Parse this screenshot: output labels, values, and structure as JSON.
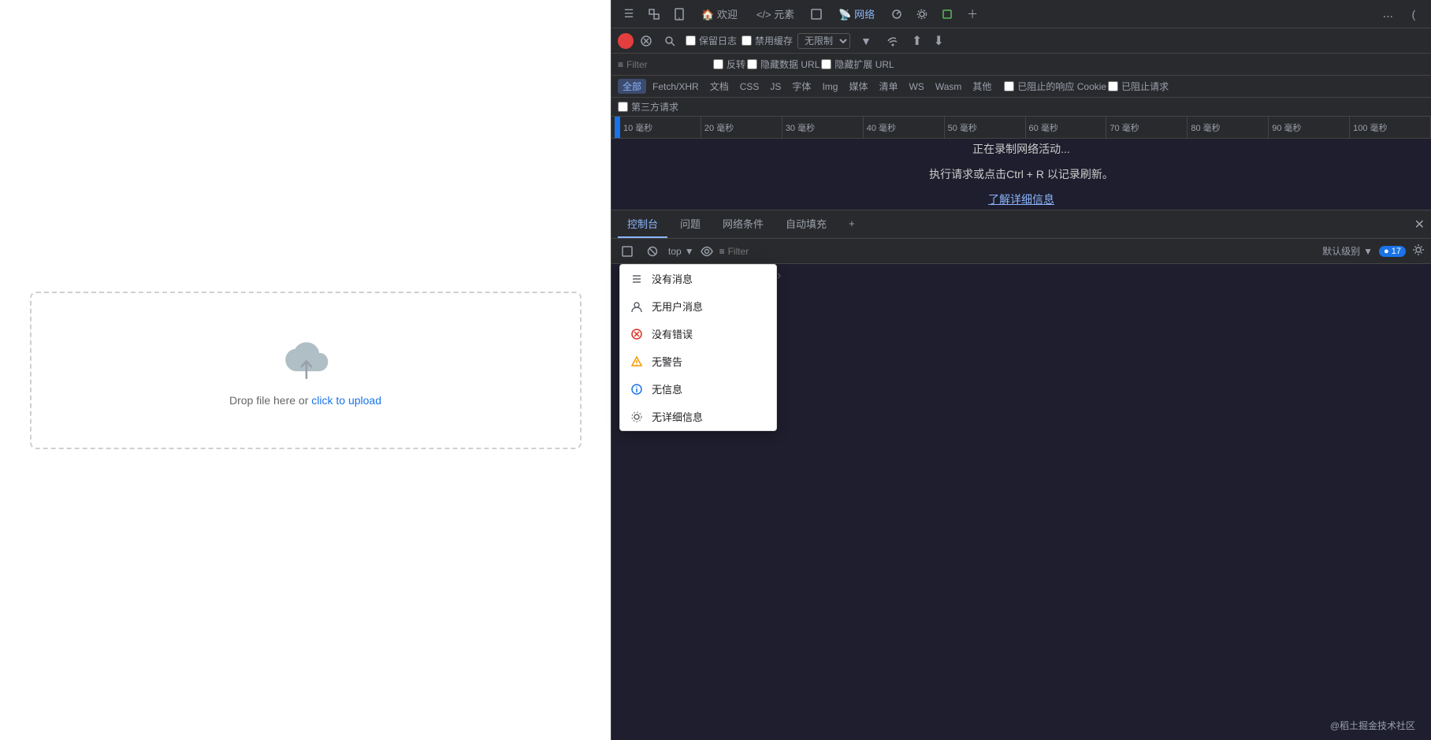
{
  "left_panel": {
    "upload": {
      "text": "Drop file here or ",
      "link_text": "click to upload"
    }
  },
  "devtools": {
    "toolbar": {
      "icon_buttons": [
        "☰",
        "⚡",
        "▭"
      ],
      "tabs": [
        {
          "id": "welcome",
          "label": "欢迎",
          "icon": "🏠"
        },
        {
          "id": "elements",
          "label": "元素",
          "icon": "</>"
        },
        {
          "id": "console2",
          "label": ""
        },
        {
          "id": "network",
          "label": "网络",
          "icon": "📡",
          "active": true
        },
        {
          "id": "perf",
          "label": ""
        },
        {
          "id": "settings2",
          "label": ""
        },
        {
          "id": "more",
          "label": "+"
        }
      ],
      "more_label": "..."
    },
    "network_toolbar": {
      "record_title": "录制",
      "clear_label": "⊘",
      "search_label": "🔍",
      "preserve_log_label": "保留日志",
      "disable_cache_label": "禁用缓存",
      "throttle_label": "无限制",
      "import_label": "⬆",
      "export_label": "⬇"
    },
    "filter_bar": {
      "filter_placeholder": "Filter",
      "invert_label": "反转",
      "hide_data_urls_label": "隐藏数据 URL",
      "hide_ext_label": "隐藏扩展 URL",
      "chips": [
        "全部",
        "Fetch/XHR",
        "文档",
        "CSS",
        "JS",
        "字体",
        "Img",
        "媒体",
        "清单",
        "WS",
        "Wasm",
        "其他"
      ],
      "blocked_label": "已阻止的响应 Cookie",
      "blocked_requests_label": "已阻止请求",
      "third_party_label": "第三方请求"
    },
    "timeline": {
      "ticks": [
        "10 毫秒",
        "20 毫秒",
        "30 毫秒",
        "40 毫秒",
        "50 毫秒",
        "60 毫秒",
        "70 毫秒",
        "80 毫秒",
        "90 毫秒",
        "100 毫秒"
      ]
    },
    "network_content": {
      "recording_text": "正在录制网络活动...",
      "hint_text": "执行请求或点击Ctrl + R 以记录刷新。",
      "link_text": "了解详细信息"
    }
  },
  "console": {
    "tabs": [
      {
        "id": "console",
        "label": "控制台",
        "active": true
      },
      {
        "id": "issues",
        "label": "问题"
      },
      {
        "id": "network_cond",
        "label": "网络条件"
      },
      {
        "id": "autofill",
        "label": "自动填充"
      },
      {
        "id": "add",
        "label": "+"
      }
    ],
    "toolbar": {
      "context_label": "top",
      "filter_placeholder": "Filter",
      "level_label": "默认级别",
      "message_count": "17"
    },
    "dropdown": {
      "items": [
        {
          "id": "no_messages",
          "label": "没有消息",
          "icon_type": "list",
          "color": "#5f6368"
        },
        {
          "id": "no_user_messages",
          "label": "无用户消息",
          "icon_type": "user",
          "color": "#5f6368"
        },
        {
          "id": "no_errors",
          "label": "没有错误",
          "icon_type": "error",
          "color": "#d93025"
        },
        {
          "id": "no_warnings",
          "label": "无警告",
          "icon_type": "warning",
          "color": "#f29900"
        },
        {
          "id": "no_info",
          "label": "无信息",
          "icon_type": "info",
          "color": "#1a73e8"
        },
        {
          "id": "no_verbose",
          "label": "无详细信息",
          "icon_type": "verbose",
          "color": "#5f6368"
        }
      ],
      "expand_icon": "›"
    }
  },
  "bottom_bar": {
    "text": "@稻土掘金技术社区"
  }
}
